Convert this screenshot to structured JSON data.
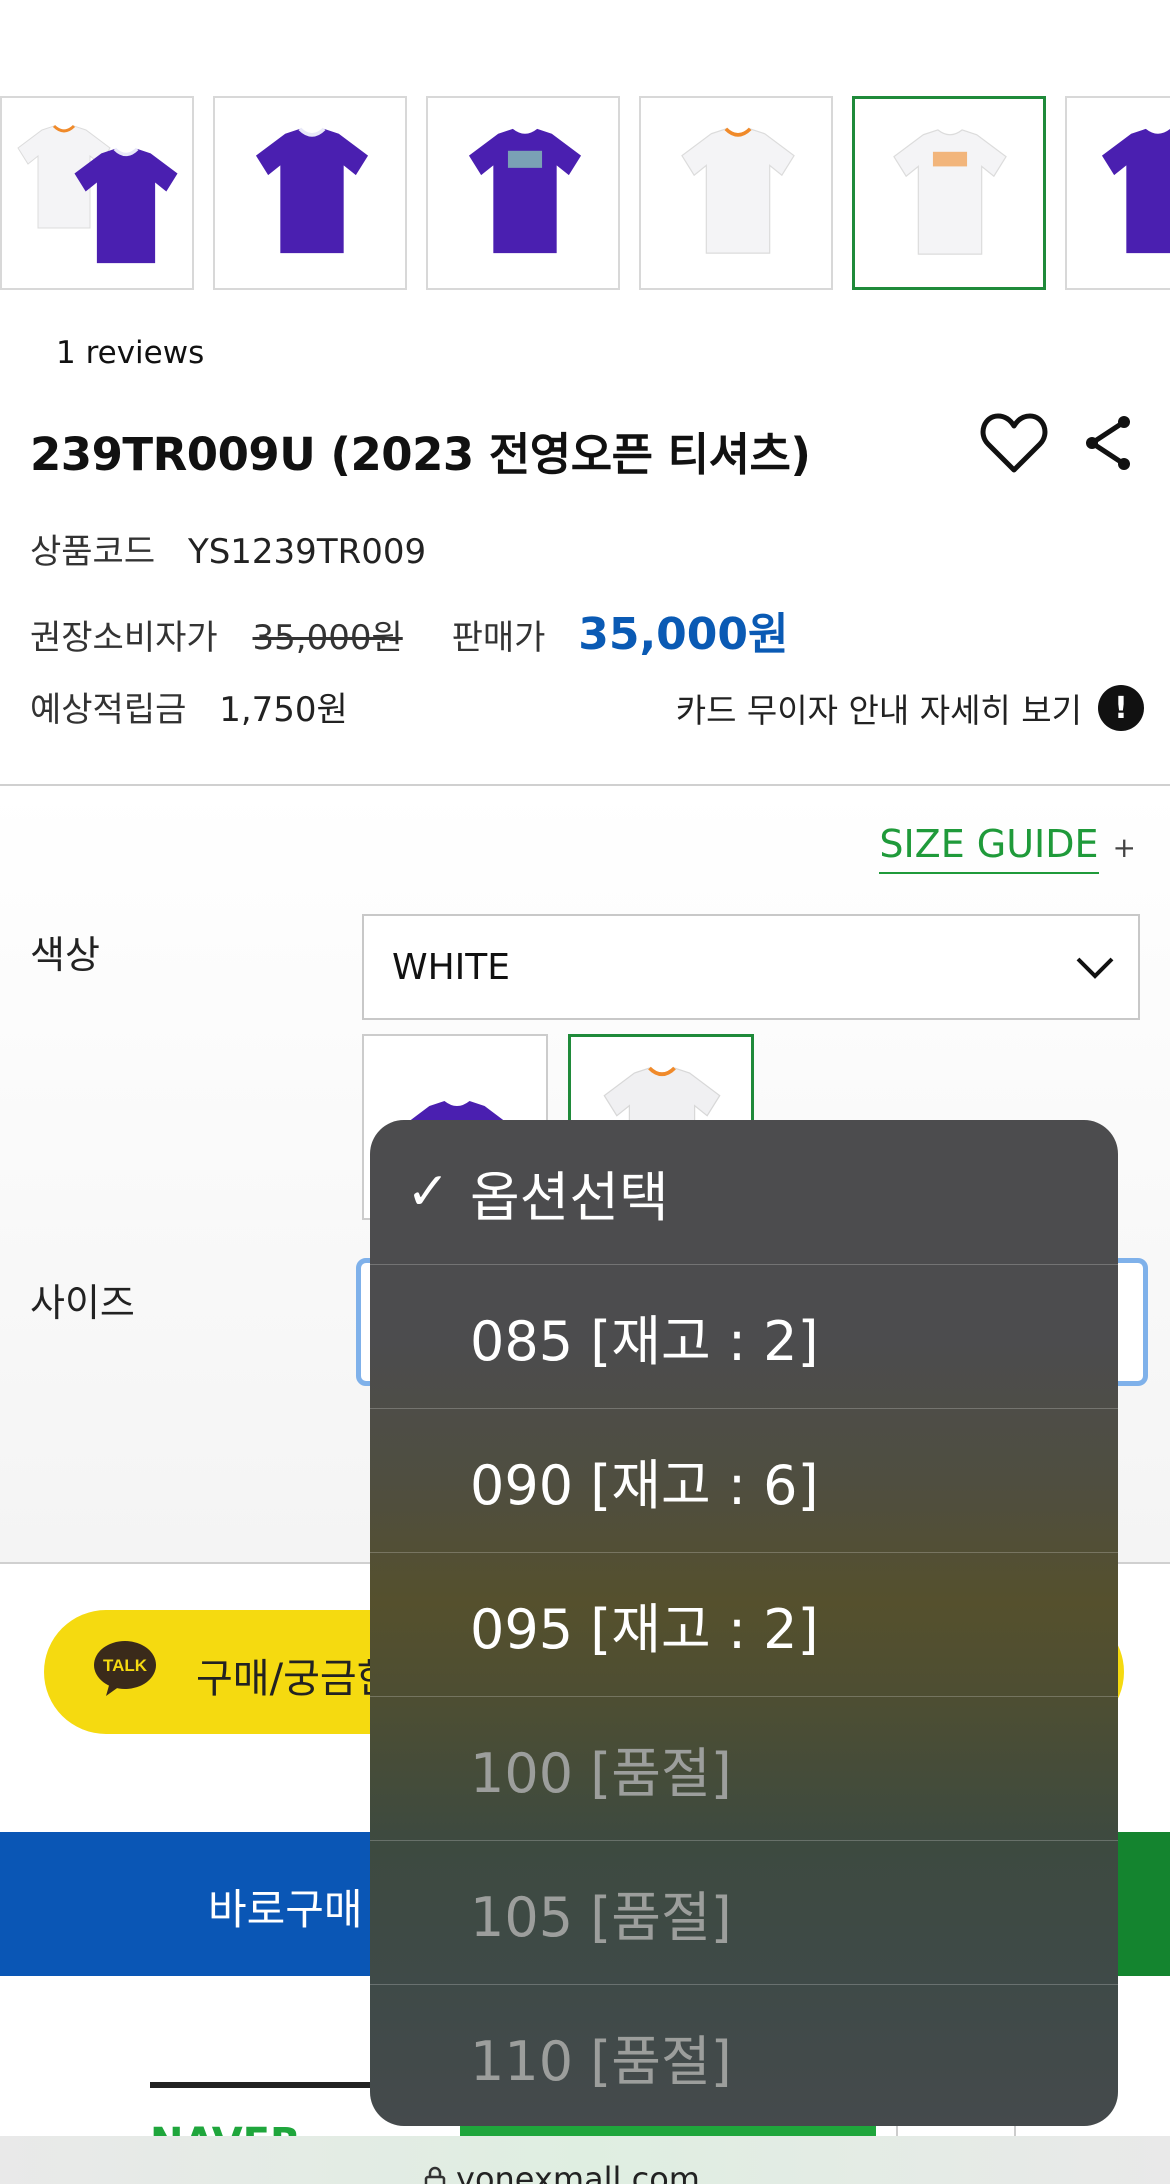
{
  "product": {
    "reviews": "1 reviews",
    "title": "239TR009U (2023 전영오픈 티셔츠)",
    "code_label": "상품코드",
    "code": "YS1239TR009",
    "msrp_label": "권장소비자가",
    "msrp": "35,000원",
    "price_label": "판매가",
    "price": "35,000원",
    "points_label": "예상적립금",
    "points": "1,750원",
    "card_info": "카드 무이자 안내 자세히 보기",
    "card_info_icon": "!"
  },
  "options": {
    "size_guide": "SIZE GUIDE",
    "size_guide_plus": "+",
    "color_label": "색상",
    "color_value": "WHITE",
    "size_label": "사이즈"
  },
  "talk": {
    "icon_text": "TALK",
    "label": "구매/궁금한"
  },
  "buy": {
    "label": "바로구매"
  },
  "bottom": {
    "naver": "NAVER",
    "url": "yonexmall.com"
  },
  "dropdown": {
    "items": [
      {
        "label": "옵션선택",
        "checked": "✓"
      },
      {
        "label": "085 [재고 : 2]"
      },
      {
        "label": "090 [재고 : 6]"
      },
      {
        "label": "095 [재고 : 2]"
      },
      {
        "label": "100 [품절]"
      },
      {
        "label": "105 [품절]"
      },
      {
        "label": "110 [품절]"
      }
    ]
  },
  "colors": {
    "accent_green": "#1f8a3a",
    "price_blue": "#0a5ab4",
    "purple_shirt": "#4a1fb0",
    "kakao_yellow": "#f5da10"
  },
  "icons": [
    "heart-icon",
    "share-icon",
    "chevron-down-icon",
    "exclamation-icon",
    "kakao-talk-icon",
    "check-icon",
    "lock-icon"
  ]
}
